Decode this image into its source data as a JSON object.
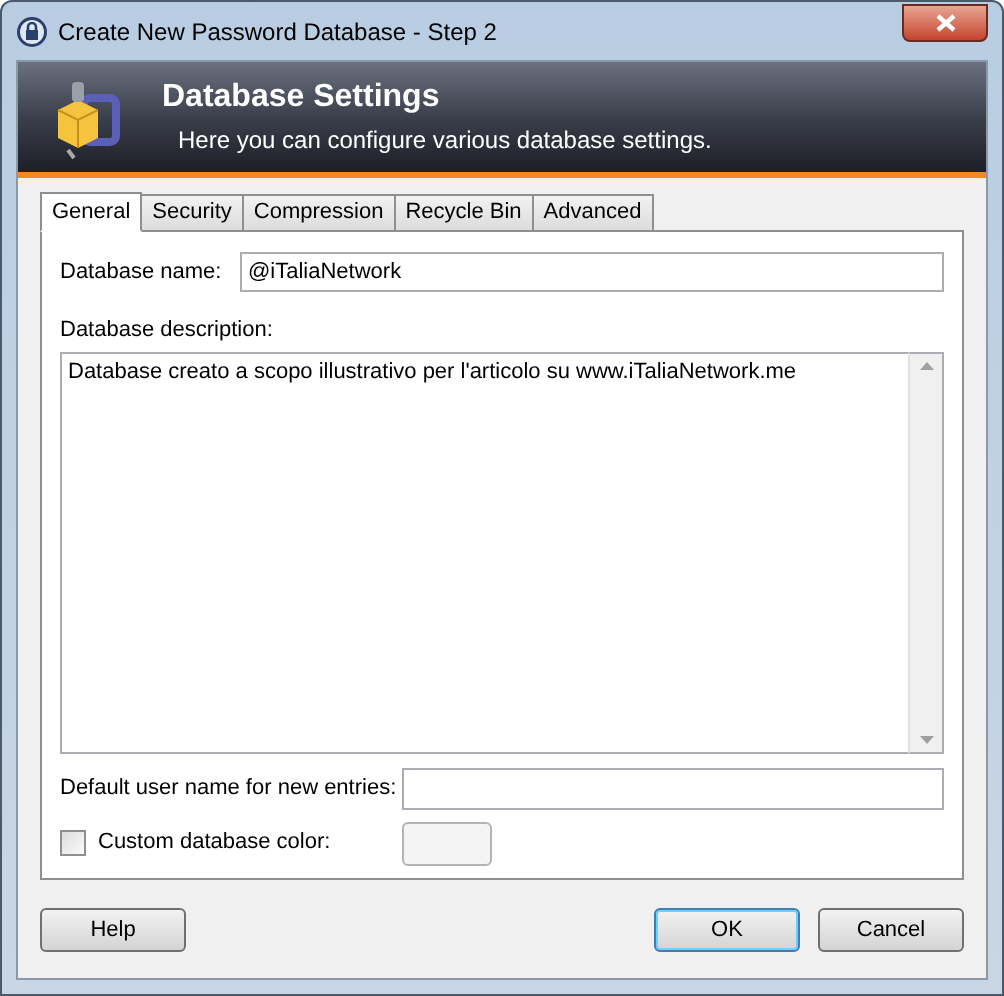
{
  "window": {
    "title": "Create New Password Database - Step 2"
  },
  "header": {
    "title": "Database Settings",
    "subtitle": "Here you can configure various database settings."
  },
  "tabs": [
    {
      "label": "General",
      "selected": true
    },
    {
      "label": "Security",
      "selected": false
    },
    {
      "label": "Compression",
      "selected": false
    },
    {
      "label": "Recycle Bin",
      "selected": false
    },
    {
      "label": "Advanced",
      "selected": false
    }
  ],
  "database_name": {
    "label": "Database name:",
    "value": "@iTaliaNetwork"
  },
  "database_description": {
    "label": "Database description:",
    "value": "Database creato a scopo illustrativo per l'articolo su www.iTaliaNetwork.me"
  },
  "default_user_name": {
    "label": "Default user name for new entries:"
  },
  "custom_color": {
    "label": "Custom database color:",
    "checked": false
  },
  "buttons": [
    {
      "label": "Help",
      "default": false
    },
    {
      "label": "OK",
      "default": true
    },
    {
      "label": "Cancel",
      "default": false
    }
  ]
}
